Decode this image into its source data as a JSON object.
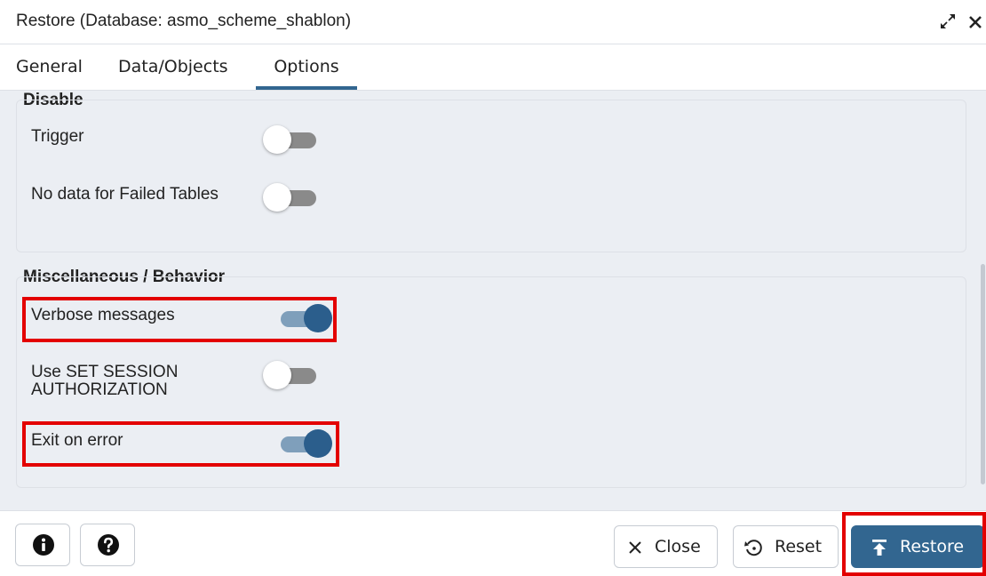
{
  "dialog": {
    "title": "Restore (Database: asmo_scheme_shablon)",
    "expand_icon": "expand-icon",
    "close_icon": "close-icon"
  },
  "tabs": [
    {
      "label": "General",
      "active": false
    },
    {
      "label": "Data/Objects",
      "active": false
    },
    {
      "label": "Options",
      "active": true
    }
  ],
  "groups": {
    "disable": {
      "label": "Disable",
      "rows": [
        {
          "label": "Trigger",
          "enabled": false
        },
        {
          "label": "No data for Failed Tables",
          "enabled": false
        }
      ]
    },
    "misc": {
      "label": "Miscellaneous / Behavior",
      "rows": [
        {
          "label": "Verbose messages",
          "enabled": true
        },
        {
          "label": "Use SET SESSION AUTHORIZATION",
          "enabled": false
        },
        {
          "label": "Exit on error",
          "enabled": true
        }
      ]
    }
  },
  "footer": {
    "info_icon": "info-icon",
    "help_icon": "help-icon",
    "close_label": "Close",
    "reset_label": "Reset",
    "restore_label": "Restore"
  },
  "colors": {
    "accent": "#326690",
    "toggle_on_track": "#7f9fbb",
    "toggle_off_track": "#8a8a8a",
    "content_bg": "#ebeef3",
    "highlight": "#e30000"
  }
}
